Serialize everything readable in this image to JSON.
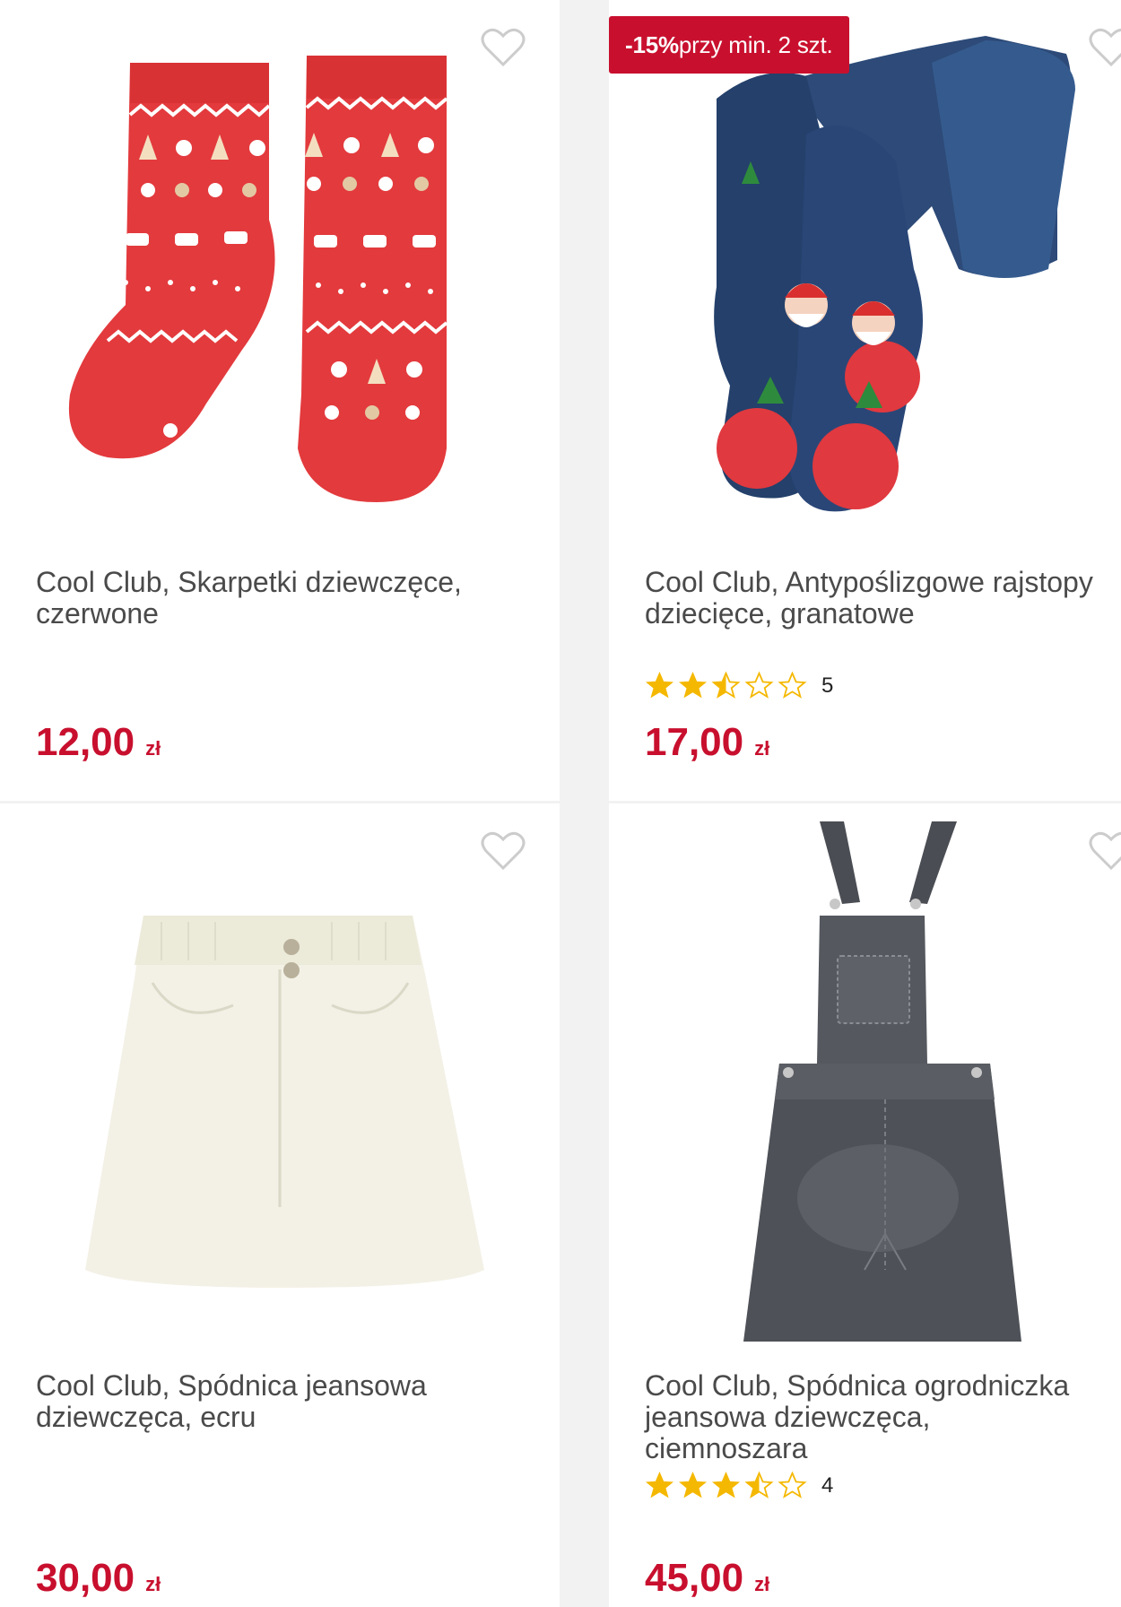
{
  "products": [
    {
      "title": "Cool Club, Skarpetki dziewczęce,\nczerwone",
      "price": "12,00",
      "currency": "zł",
      "rating_count": "",
      "image": "red-christmas-socks"
    },
    {
      "promo_percent": "-15%",
      "promo_text": " przy min. 2 szt.",
      "title": "Cool Club, Antypoślizgowe rajstopy\ndziecięce, granatowe",
      "rating": 2.5,
      "rating_count": "5",
      "price": "17,00",
      "currency": "zł",
      "image": "navy-santa-tights"
    },
    {
      "title": "Cool Club, Spódnica jeansowa\ndziewczęca, ecru",
      "price": "30,00",
      "currency": "zł",
      "image": "ecru-denim-skirt"
    },
    {
      "title": "Cool Club, Spódnica ogrodniczka\njeansowa dziewczęca,\nciemnoszara",
      "rating": 3.5,
      "rating_count": "4",
      "price": "45,00",
      "currency": "zł",
      "image": "dark-grey-denim-pinafore"
    }
  ],
  "colors": {
    "accent": "#c8102e",
    "star": "#f5b800",
    "text": "#4a4a4a"
  },
  "icons": [
    "heart-icon",
    "star-full-icon",
    "star-half-icon",
    "star-empty-icon"
  ]
}
